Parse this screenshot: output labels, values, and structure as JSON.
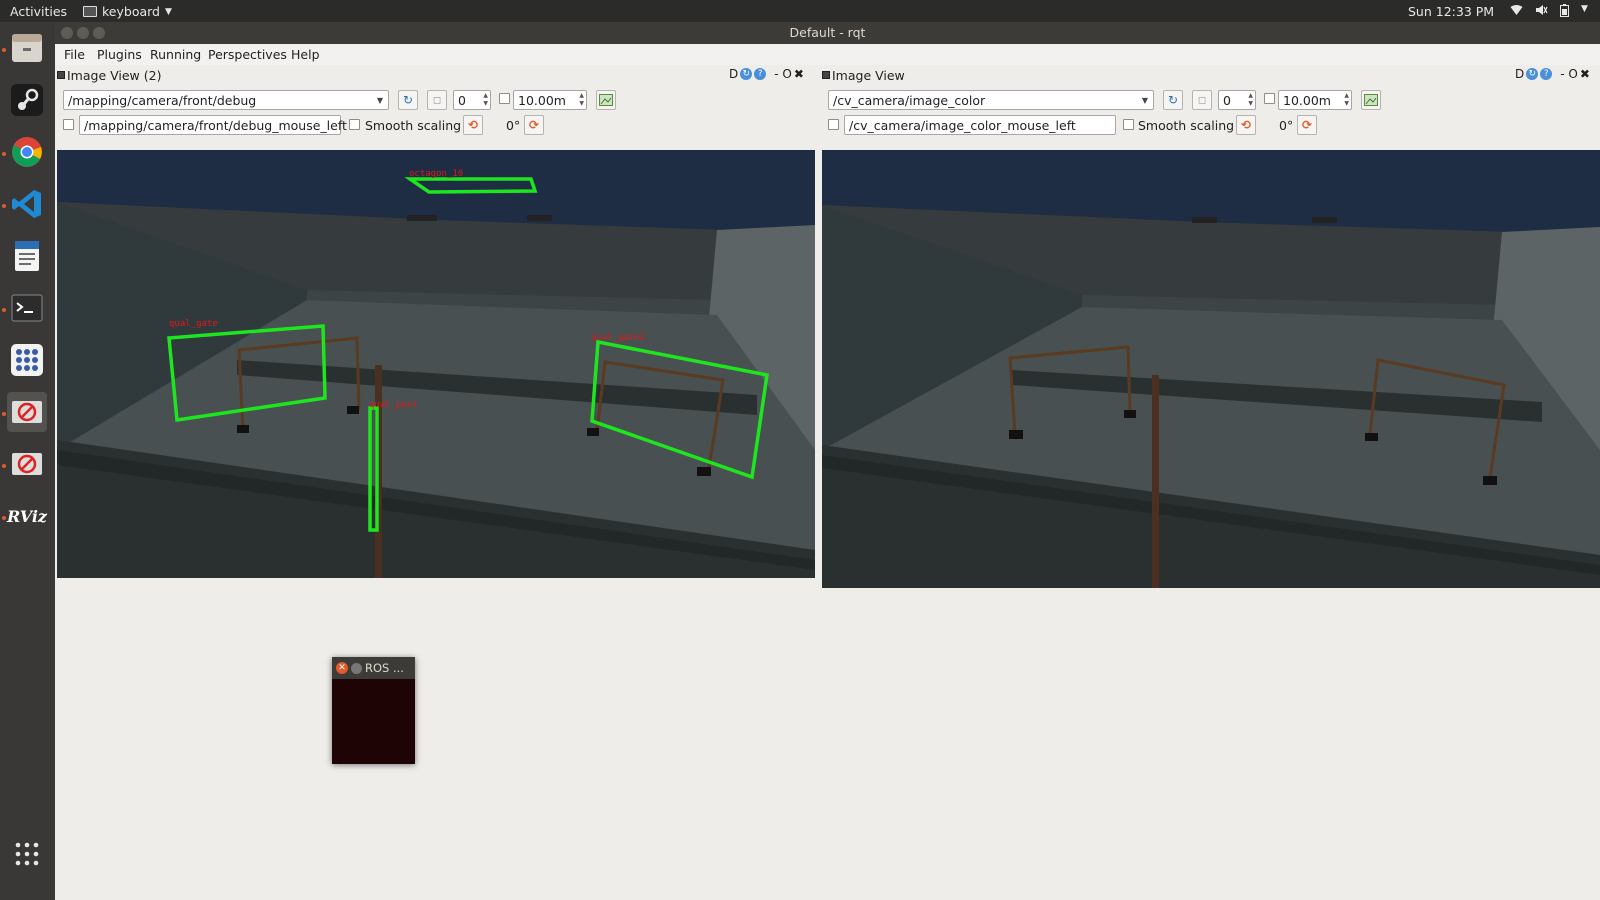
{
  "topbar": {
    "activities": "Activities",
    "app_name": "keyboard",
    "clock": "Sun 12:33 PM",
    "tray": [
      "wifi-icon",
      "volume-icon",
      "battery-icon",
      "menu-caret-icon"
    ]
  },
  "dock": {
    "items": [
      "file-manager-icon",
      "steam-icon",
      "chrome-icon",
      "vscode-icon",
      "text-editor-icon",
      "terminal-icon",
      "apps-grid-icon",
      "ros-icon",
      "ros-icon-2",
      "rviz-icon"
    ],
    "rviz_label": "RViz",
    "show_apps": "show-applications-icon"
  },
  "window": {
    "title": "Default - rqt",
    "menu": [
      "File",
      "Plugins",
      "Running",
      "Perspectives",
      "Help"
    ]
  },
  "panels": [
    {
      "title": "Image View (2)",
      "header_letter": "D",
      "header_btns": "- O",
      "topic": "/mapping/camera/front/debug",
      "spin_value": "0",
      "max_range": "10.00m",
      "mouse_topic": "/mapping/camera/front/debug_mouse_left",
      "smooth_label": "Smooth scaling",
      "rotation": "0°",
      "detections": [
        "octagon_10",
        "qual_gate",
        "qual_post",
        "qual_gate2"
      ]
    },
    {
      "title": "Image View",
      "header_letter": "D",
      "header_btns": "- O",
      "topic": "/cv_camera/image_color",
      "spin_value": "0",
      "max_range": "10.00m",
      "mouse_topic": "/cv_camera/image_color_mouse_left",
      "smooth_label": "Smooth scaling",
      "rotation": "0°"
    }
  ],
  "ros_window": {
    "title": "ROS ..."
  },
  "colors": {
    "detection_box": "#1ee61e",
    "detection_label": "#e01818",
    "pool_wall": "#3a4040",
    "sky": "#1e2d44"
  }
}
